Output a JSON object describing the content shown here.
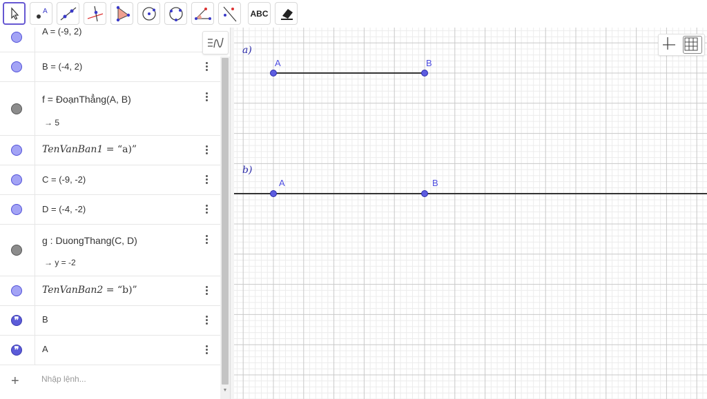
{
  "toolbar": {
    "tools": [
      {
        "name": "move-tool",
        "icon": "cursor-arrow-icon",
        "active": true
      },
      {
        "name": "point-tool",
        "icon": "point-icon"
      },
      {
        "name": "line-tool",
        "icon": "line-through-two-points-icon"
      },
      {
        "name": "perpendicular-line-tool",
        "icon": "perpendicular-line-icon"
      },
      {
        "name": "polygon-tool",
        "icon": "polygon-icon"
      },
      {
        "name": "circle-center-point-tool",
        "icon": "circle-center-point-icon"
      },
      {
        "name": "circle-three-points-tool",
        "icon": "circle-three-points-icon"
      },
      {
        "name": "angle-tool",
        "icon": "angle-icon"
      },
      {
        "name": "reflect-tool",
        "icon": "reflect-about-line-icon"
      },
      {
        "name": "text-tool",
        "icon": "text-icon",
        "label": "ABC"
      },
      {
        "name": "eraser-tool",
        "icon": "eraser-icon"
      }
    ]
  },
  "algebra": {
    "items": [
      {
        "id": "A",
        "definition": "A = (-9, 2)",
        "marble": "blue"
      },
      {
        "id": "B",
        "definition": "B = (-4, 2)",
        "marble": "blue"
      },
      {
        "id": "f",
        "definition": "f = ĐoạnThẳng(A, B)",
        "value": "→ 5",
        "marble": "dark"
      },
      {
        "id": "TenVanBan1",
        "name": "TenVanBan1",
        "rest": " = “a)”",
        "marble": "blue"
      },
      {
        "id": "C",
        "definition": "C = (-9, -2)",
        "marble": "blue"
      },
      {
        "id": "D",
        "definition": "D = (-4, -2)",
        "marble": "blue"
      },
      {
        "id": "g",
        "definition": "g : DuongThang(C, D)",
        "value": "→ y = -2",
        "marble": "dark"
      },
      {
        "id": "TenVanBan2",
        "name": "TenVanBan2",
        "rest": " = “b)”",
        "marble": "blue"
      },
      {
        "id": "textB",
        "text": "B",
        "marble": "quote"
      },
      {
        "id": "textA",
        "text": "A",
        "marble": "quote"
      }
    ],
    "input_placeholder": "Nhập lệnh..."
  },
  "graphics": {
    "text_a": "a)",
    "text_b": "b)",
    "points": {
      "A1": "A",
      "B1": "B",
      "A2": "A",
      "B2": "B"
    },
    "colors": {
      "point": "#5050d8",
      "segment": "#333333",
      "grid_major": "#c8c8c8",
      "grid_minor": "#ececec"
    }
  }
}
